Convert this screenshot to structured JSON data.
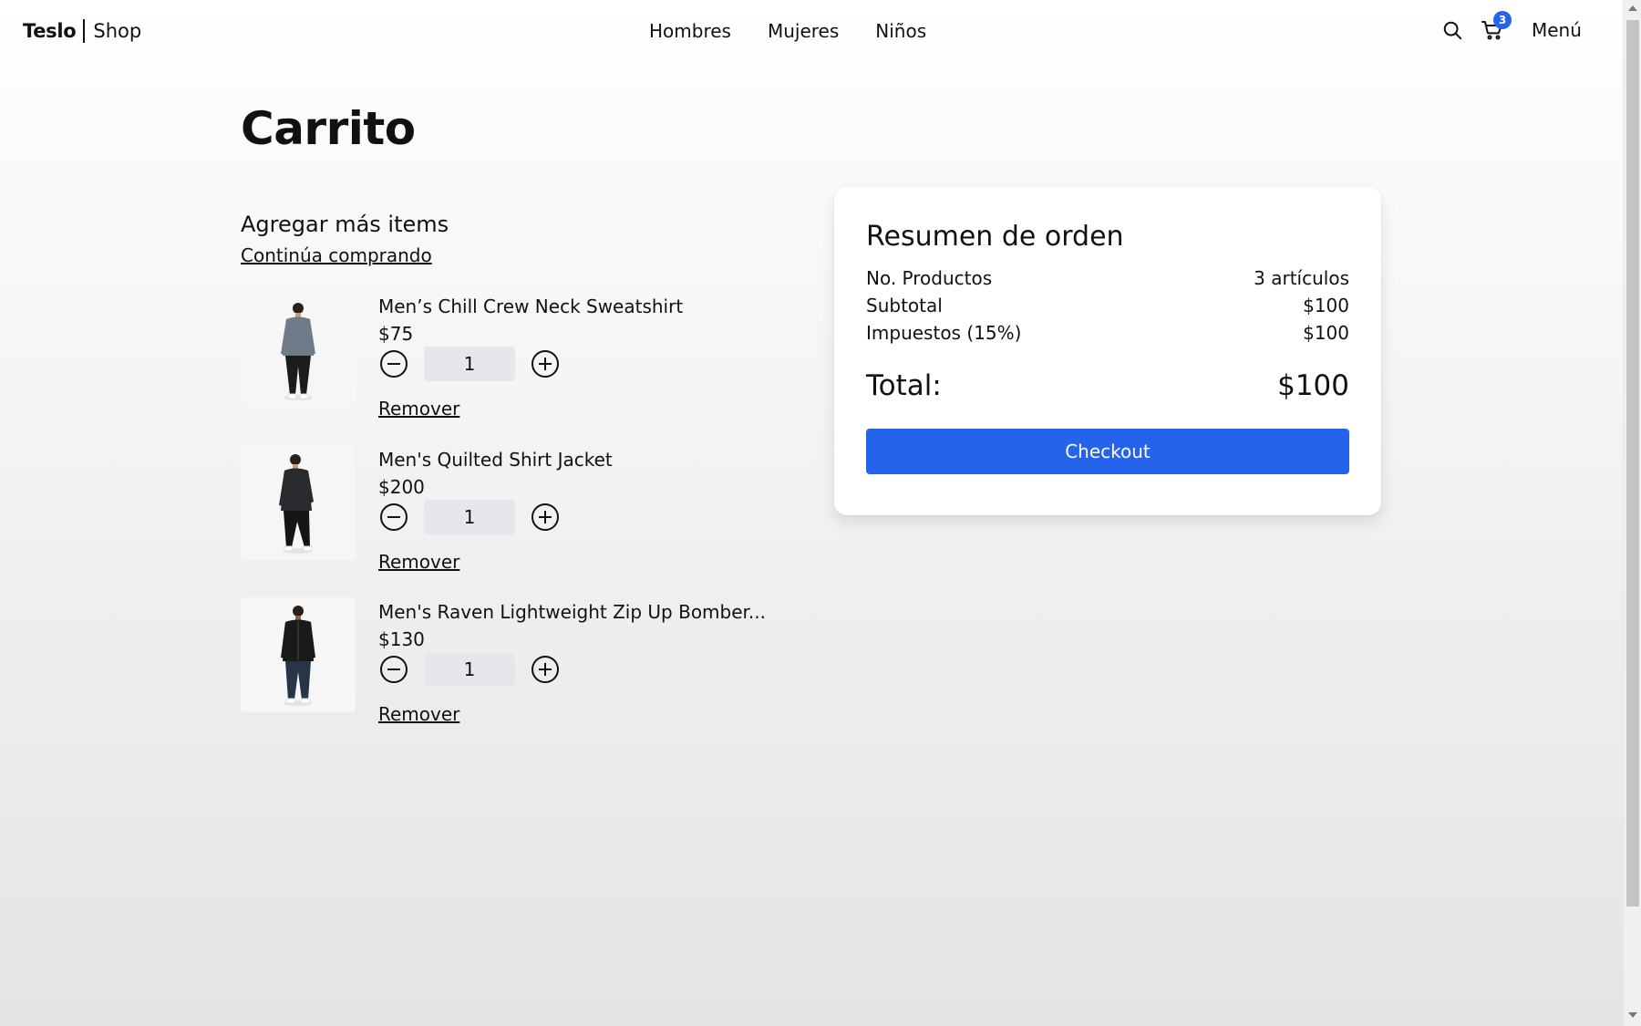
{
  "navbar": {
    "brand_main": "Teslo",
    "brand_sub": "Shop",
    "links": [
      "Hombres",
      "Mujeres",
      "Niños"
    ],
    "cart_count": "3",
    "menu_label": "Menú"
  },
  "page": {
    "title": "Carrito",
    "add_more": "Agregar más items",
    "continue_link": "Continúa comprando"
  },
  "items": [
    {
      "name": "Men’s Chill Crew Neck Sweatshirt",
      "price": "$75",
      "quantity": "1",
      "remove_label": "Remover",
      "shirt_color": "#6f7b88",
      "pants_color": "#1c1c1c"
    },
    {
      "name": "Men's Quilted Shirt Jacket",
      "price": "$200",
      "quantity": "1",
      "remove_label": "Remover",
      "shirt_color": "#2a2b2e",
      "pants_color": "#151515"
    },
    {
      "name": "Men's Raven Lightweight Zip Up Bomber...",
      "price": "$130",
      "quantity": "1",
      "remove_label": "Remover",
      "shirt_color": "#1a1a1a",
      "pants_color": "#283548"
    }
  ],
  "summary": {
    "title": "Resumen de orden",
    "rows": [
      {
        "label": "No. Productos",
        "value": "3 artículos"
      },
      {
        "label": "Subtotal",
        "value": "$100"
      },
      {
        "label": "Impuestos (15%)",
        "value": "$100"
      }
    ],
    "total_label": "Total:",
    "total_value": "$100",
    "checkout_label": "Checkout"
  },
  "colors": {
    "accent": "#2563eb",
    "qty_bg": "#e5e7eb"
  }
}
